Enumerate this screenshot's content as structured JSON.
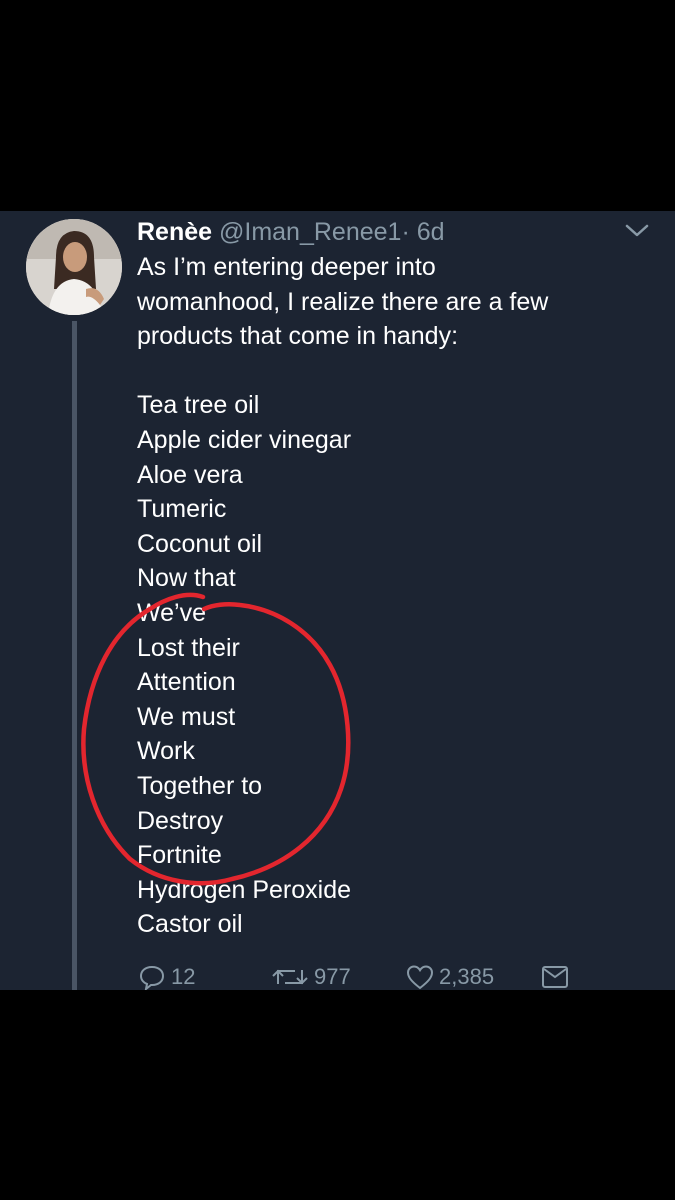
{
  "tweet": {
    "display_name": "Renèe",
    "handle": "@Iman_Renee1",
    "separator": "·",
    "time": "6d",
    "lines": [
      "As I’m entering deeper into",
      "womanhood, I realize there are a few",
      "products that come in handy:",
      "",
      "Tea tree oil",
      "Apple cider vinegar",
      "Aloe vera",
      "Tumeric",
      "Coconut oil",
      "Now that",
      "We’ve",
      "Lost their",
      "Attention",
      "We must",
      "Work",
      "Together to",
      "Destroy",
      "Fortnite",
      "Hydrogen Peroxide",
      "Castor oil"
    ],
    "reply_count": "12",
    "retweet_count": "977",
    "like_count": "2,385"
  },
  "icons": {
    "reply": "speech-bubble-icon",
    "retweet": "retweet-arrows-icon",
    "like": "heart-icon",
    "dm": "envelope-icon",
    "menu": "chevron-down-icon"
  },
  "colors": {
    "tweet_background": "#1c2432",
    "text": "#ffffff",
    "secondary_text": "#8899a6",
    "annotation": "#e3262e"
  }
}
